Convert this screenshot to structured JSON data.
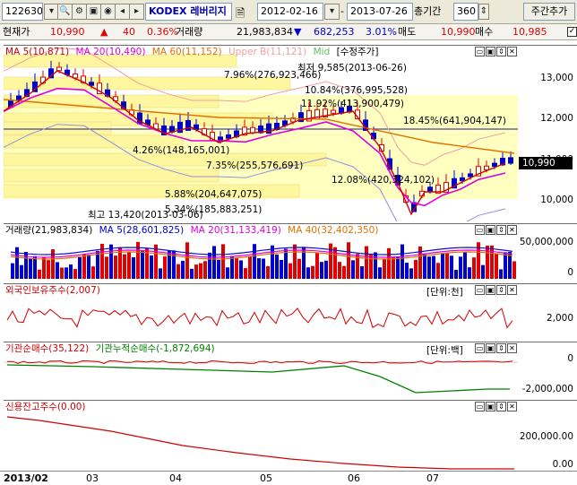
{
  "toolbar": {
    "code": "122630",
    "name": "KODEX 레버리지",
    "start_date": "2012-02-16",
    "end_date": "2013-07-26",
    "period_label": "총기간",
    "period_value": "360",
    "view_button": "주간추가"
  },
  "quote": {
    "current_label": "현재가",
    "current_price": "10,990",
    "change_arrow": "▲",
    "change": "40",
    "change_pct": "0.36%",
    "volume_label": "거래량",
    "volume": "21,983,834",
    "volume_change_arrow": "▼",
    "volume_change": "682,253",
    "volume_change_pct": "3.01%",
    "sell_label": "매도",
    "sell_price": "10,990",
    "buy_label": "매수",
    "buy_price": "10,985"
  },
  "price_panel": {
    "legend": [
      "MA 5(10,871)",
      "MA 20(10,490)",
      "MA 60(11,152)",
      "Upper B(11,121)",
      "Mid",
      "[수정주가]"
    ],
    "ticks": [
      "13,000",
      "12,000",
      "11,000",
      "10,000"
    ],
    "current_tag": "10,990",
    "annotations": [
      "최저 9,585(2013-06-26)",
      "7.96%(276,923,466)",
      "10.84%(376,995,528)",
      "11.92%(413,900,479)",
      "18.45%(641,904,147)",
      "4.26%(148,165,001)",
      "7.35%(255,576,691)",
      "12.08%(420,324,102)",
      "5.88%(204,647,075)",
      "5.34%(185,883,251)",
      "최고 13,420(2013-03-06)"
    ]
  },
  "volume_panel": {
    "legend": [
      "거래량(21,983,834)",
      "MA 5(28,601,825)",
      "MA 20(31,133,419)",
      "MA 40(32,402,350)"
    ],
    "ticks": [
      "50,000,000",
      "0"
    ]
  },
  "foreign_panel": {
    "legend": [
      "외국인보유주수(2,007)"
    ],
    "unit": "[단위:천]",
    "ticks": [
      "2,000"
    ]
  },
  "inst_panel": {
    "legend": [
      "기관순매수(35,122)",
      "기관누적순매수(-1,872,694)"
    ],
    "unit": "[단위:백]",
    "ticks": [
      "0",
      "-2,000,000"
    ]
  },
  "credit_panel": {
    "legend": [
      "신용잔고주수(0.00)"
    ],
    "ticks": [
      "200,000.00",
      "0.00"
    ]
  },
  "x_axis": [
    "2013/02",
    "03",
    "04",
    "05",
    "06",
    "07"
  ],
  "colors": {
    "up": "#e00000",
    "down": "#0000cc",
    "ma5": "#d00000",
    "ma20": "#e000e0",
    "ma60": "#e07000",
    "upper_band": "#f0a0a0",
    "mid": "#90e090"
  }
}
